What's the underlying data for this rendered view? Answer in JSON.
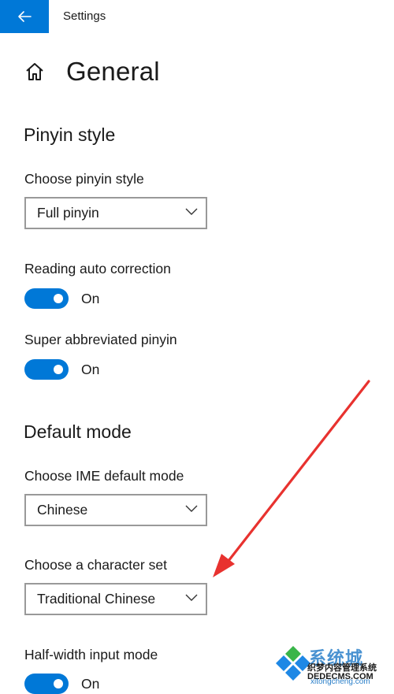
{
  "window": {
    "title": "Settings"
  },
  "header": {
    "page_title": "General"
  },
  "sections": {
    "pinyin_style": {
      "title": "Pinyin style",
      "choose_label": "Choose pinyin style",
      "choose_value": "Full pinyin",
      "reading_auto_correction": {
        "label": "Reading auto correction",
        "state": "On"
      },
      "super_abbreviated": {
        "label": "Super abbreviated pinyin",
        "state": "On"
      }
    },
    "default_mode": {
      "title": "Default mode",
      "ime_label": "Choose IME default mode",
      "ime_value": "Chinese",
      "charset_label": "Choose a character set",
      "charset_value": "Traditional Chinese",
      "half_width": {
        "label": "Half-width input mode",
        "state": "On"
      }
    }
  },
  "watermark": {
    "line1": "系统城",
    "line2": "织梦内容管理系统",
    "line3": "DEDECMS.COM",
    "line4": "xitongcheng.com"
  },
  "colors": {
    "accent": "#0078d7",
    "annotation_arrow": "#e8322f",
    "dropdown_border": "#999999"
  },
  "icons": {
    "back": "arrow-left-icon",
    "home": "home-icon",
    "dropdown": "chevron-down-icon"
  }
}
